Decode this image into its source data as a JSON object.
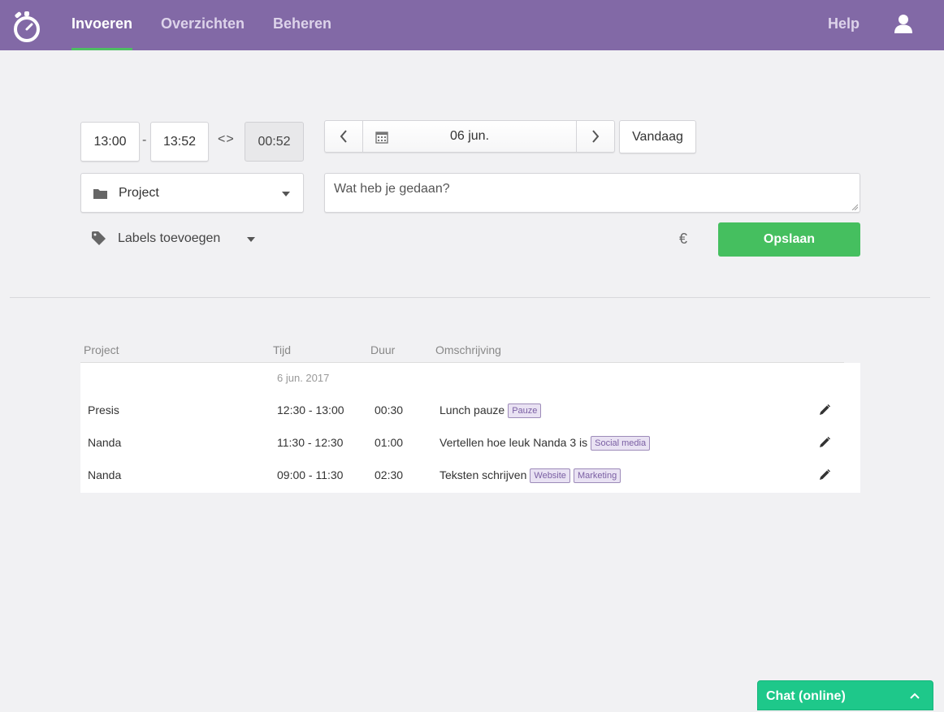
{
  "nav": {
    "logo_icon": "stopwatch-icon",
    "items": [
      {
        "label": "Invoeren",
        "active": true
      },
      {
        "label": "Overzichten",
        "active": false
      },
      {
        "label": "Beheren",
        "active": false
      }
    ],
    "help": "Help",
    "user_icon": "user-icon",
    "brand_color": "#8269a6",
    "active_indicator_color": "#4ebf63"
  },
  "entry": {
    "start_time": "13:00",
    "separator": "-",
    "end_time": "13:52",
    "swap_symbol": "<>",
    "duration": "00:52",
    "date": "06 jun.",
    "today_button": "Vandaag",
    "project_placeholder": "Project",
    "description_placeholder": "Wat heb je gedaan?",
    "labels_placeholder": "Labels toevoegen",
    "currency_symbol": "€",
    "save_button": "Opslaan",
    "save_color": "#45bf5f"
  },
  "table": {
    "columns": [
      "Project",
      "Tijd",
      "Duur",
      "Omschrijving"
    ],
    "day": "6 jun. 2017",
    "rows": [
      {
        "project": "Presis",
        "time": "12:30 - 13:00",
        "duration": "00:30",
        "description": "Lunch pauze",
        "tags": [
          "Pauze"
        ]
      },
      {
        "project": "Nanda",
        "time": "11:30 - 12:30",
        "duration": "01:00",
        "description": "Vertellen hoe leuk Nanda 3 is",
        "tags": [
          "Social media"
        ]
      },
      {
        "project": "Nanda",
        "time": "09:00 - 11:30",
        "duration": "02:30",
        "description": "Teksten schrijven",
        "tags": [
          "Website",
          "Marketing"
        ]
      }
    ]
  },
  "chat": {
    "label": "Chat (online)",
    "color": "#1ec88a"
  }
}
